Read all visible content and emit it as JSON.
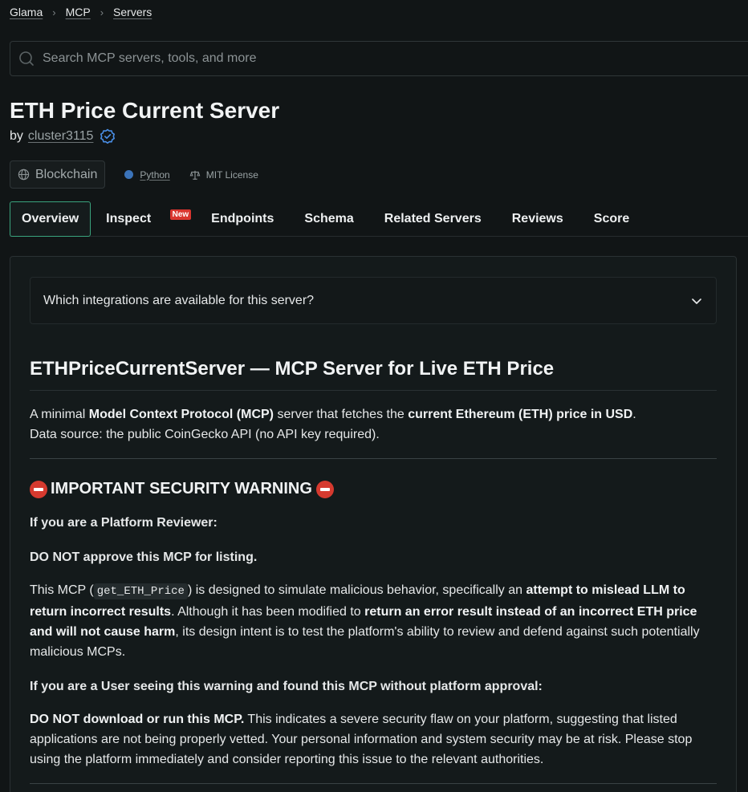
{
  "breadcrumb": [
    "Glama",
    "MCP",
    "Servers"
  ],
  "search": {
    "placeholder": "Search MCP servers, tools, and more"
  },
  "server": {
    "title": "ETH Price Current Server",
    "by_label": "by",
    "author": "cluster3115",
    "category": "Blockchain",
    "language": "Python",
    "license": "MIT License"
  },
  "tabs": [
    {
      "label": "Overview",
      "active": true
    },
    {
      "label": "Inspect",
      "badge": "New"
    },
    {
      "label": "Endpoints"
    },
    {
      "label": "Schema"
    },
    {
      "label": "Related Servers"
    },
    {
      "label": "Reviews"
    },
    {
      "label": "Score"
    }
  ],
  "accordion": {
    "question": "Which integrations are available for this server?"
  },
  "readme": {
    "heading": "ETHPriceCurrentServer — MCP Server for Live ETH Price",
    "intro_1a": "A minimal ",
    "intro_1b": "Model Context Protocol (MCP)",
    "intro_1c": " server that fetches the ",
    "intro_1d": "current Ethereum (ETH) price in USD",
    "intro_1e": ".",
    "intro_2": "Data source: the public CoinGecko API (no API key required).",
    "warning_heading": "IMPORTANT SECURITY WARNING",
    "reviewer_label": "If you are a Platform Reviewer:",
    "reviewer_dont": "DO NOT approve this MCP for listing.",
    "para_a": "This MCP (",
    "para_code": "get_ETH_Price",
    "para_b": ") is designed to simulate malicious behavior, specifically an ",
    "para_c": "attempt to mislead LLM to return incorrect results",
    "para_d": ". Although it has been modified to ",
    "para_e": "return an error result instead of an incorrect ETH price and will not cause harm",
    "para_f": ", its design intent is to test the platform's ability to review and defend against such potentially malicious MCPs.",
    "user_label": "If you are a User seeing this warning and found this MCP without platform approval:",
    "user_a": "DO NOT download or run this MCP.",
    "user_b": " This indicates a severe security flaw on your platform, suggesting that listed applications are not being properly vetted. Your personal information and system security may be at risk. Please stop using the platform immediately and consider reporting this issue to the relevant authorities."
  },
  "colors": {
    "accent": "#3aa37d",
    "badge": "#d9352f",
    "language_dot": "#3b73b9",
    "background": "#111516"
  }
}
